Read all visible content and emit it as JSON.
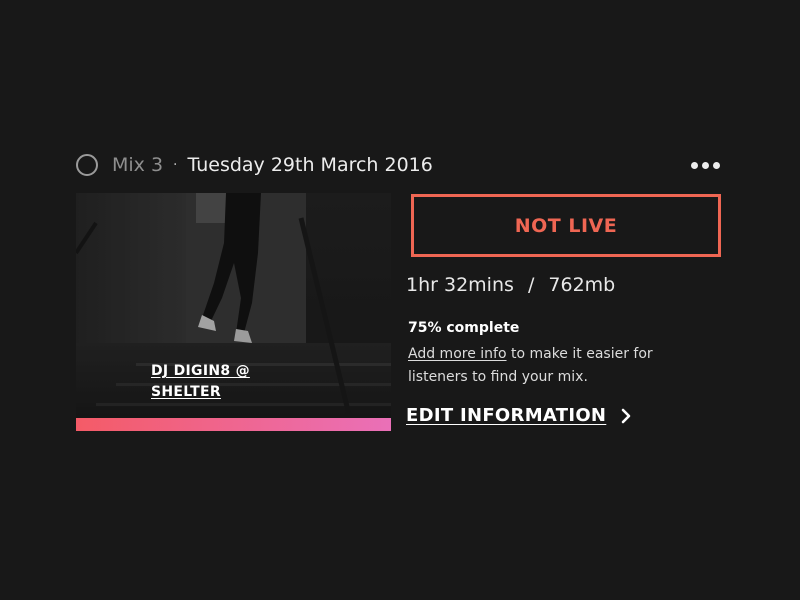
{
  "mix": {
    "name": "Mix 3",
    "separator": "·",
    "date": "Tuesday 29th March 2016"
  },
  "artwork": {
    "title": "DJ DIGIN8 @ SHELTER",
    "progress": 1.0,
    "gradient_start": "#f45b67",
    "gradient_end": "#ea70b8"
  },
  "status": {
    "label": "NOT LIVE",
    "color": "#ef6653"
  },
  "stats": {
    "duration": "1hr 32mins",
    "separator": "/",
    "size": "762mb"
  },
  "completion": {
    "label": "75% complete",
    "percent": 75
  },
  "info": {
    "link_text": "Add more info",
    "text": " to make it easier for listeners to find your mix."
  },
  "edit": {
    "label": "EDIT INFORMATION",
    "icon": "chevron-right-icon"
  },
  "menu": {
    "icon": "more-horizontal-icon"
  }
}
